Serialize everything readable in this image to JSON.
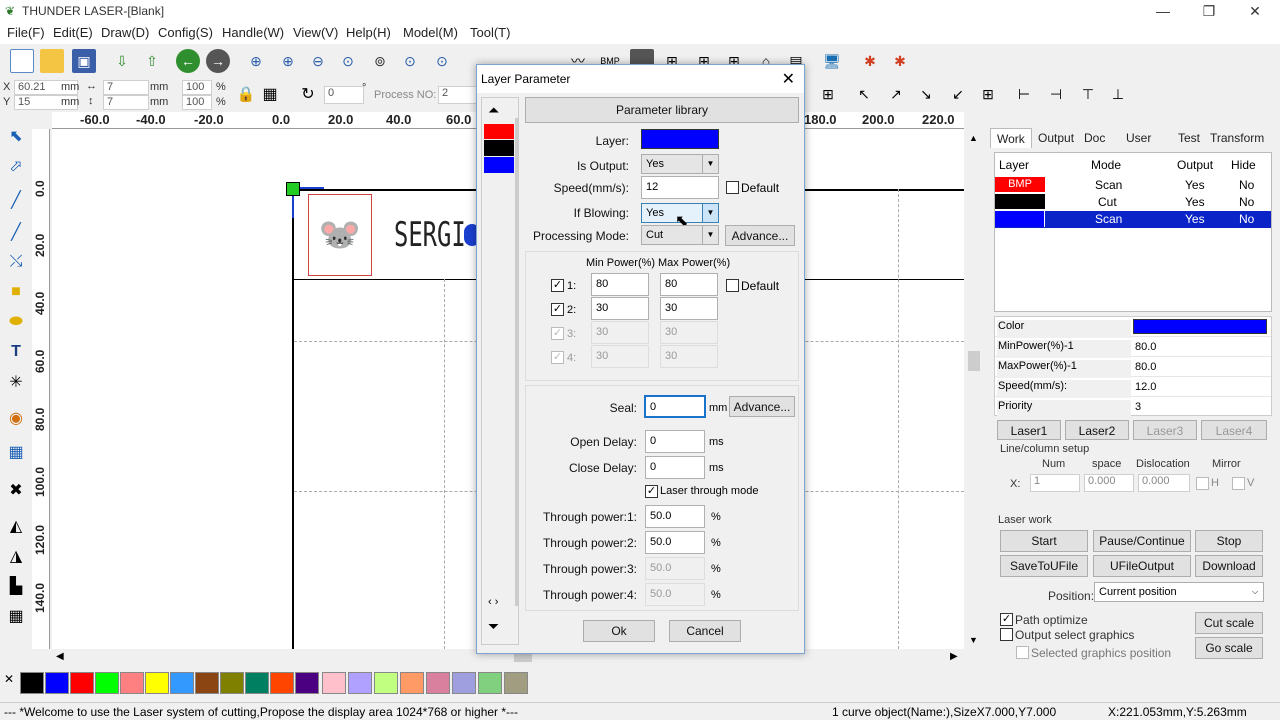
{
  "app": {
    "title": "THUNDER LASER-[Blank]"
  },
  "menu": [
    "File(F)",
    "Edit(E)",
    "Draw(D)",
    "Config(S)",
    "Handle(W)",
    "View(V)",
    "Help(H)",
    "Model(M)",
    "Tool(T)"
  ],
  "coords": {
    "x_label": "X",
    "x_value": "60.21",
    "y_label": "Y",
    "y_value": "15",
    "unit": "mm",
    "w_value": "7",
    "h_value": "7",
    "w_pct": "100",
    "h_pct": "100",
    "pct": "%",
    "rotate": "0",
    "deg": "°",
    "process_label": "Process NO:",
    "process_value": "2"
  },
  "ruler_h": [
    "-60.0",
    "-40.0",
    "-20.0",
    "0.0",
    "20.0",
    "40.0",
    "60.0",
    "180.0",
    "200.0",
    "220.0"
  ],
  "ruler_v": [
    "0.0",
    "20.0",
    "40.0",
    "60.0",
    "80.0",
    "100.0",
    "120.0",
    "140.0"
  ],
  "canvas": {
    "text": "SERGI"
  },
  "right_tabs": [
    "Work",
    "Output",
    "Doc",
    "User",
    "Test",
    "Transform"
  ],
  "layer_table": {
    "headers": [
      "Layer",
      "Mode",
      "Output",
      "Hide"
    ],
    "rows": [
      {
        "layer": "BMP",
        "color": "#ff0000",
        "mode": "Scan",
        "output": "Yes",
        "hide": "No"
      },
      {
        "layer": "",
        "color": "#000000",
        "mode": "Cut",
        "output": "Yes",
        "hide": "No"
      },
      {
        "layer": "",
        "color": "#0000ff",
        "mode": "Scan",
        "output": "Yes",
        "hide": "No"
      }
    ]
  },
  "props": [
    {
      "k": "Color",
      "v": ""
    },
    {
      "k": "MinPower(%)-1",
      "v": "80.0"
    },
    {
      "k": "MaxPower(%)-1",
      "v": "80.0"
    },
    {
      "k": "Speed(mm/s):",
      "v": "12.0"
    },
    {
      "k": "Priority",
      "v": "3"
    }
  ],
  "lasers": [
    "Laser1",
    "Laser2",
    "Laser3",
    "Laser4"
  ],
  "linecol": {
    "title": "Line/column setup",
    "num": "Num",
    "space": "space",
    "dislocation": "Dislocation",
    "mirror": "Mirror",
    "x": "X:",
    "num_v": "1",
    "space_v": "0.000",
    "disl_v": "0.000",
    "h": "H",
    "v": "V"
  },
  "laser_work": {
    "title": "Laser work",
    "start": "Start",
    "pause": "Pause/Continue",
    "stop": "Stop",
    "save": "SaveToUFile",
    "ufile": "UFileOutput",
    "download": "Download",
    "position_label": "Position:",
    "position_value": "Current position",
    "path_opt": "Path optimize",
    "output_sel": "Output select graphics",
    "sel_pos": "Selected graphics position",
    "cut_scale": "Cut scale",
    "go_scale": "Go scale"
  },
  "palette": [
    "#000000",
    "#0000ff",
    "#ff0000",
    "#00ff00",
    "#ff8080",
    "#ffff00",
    "#3399ff",
    "#8b4513",
    "#808000",
    "#008060",
    "#ff4500",
    "#4b0082",
    "#ffc0cb",
    "#b0a0ff",
    "#c0ff80",
    "#ff9966",
    "#d9809f",
    "#9f9fdf",
    "#80d080",
    "#a09d80"
  ],
  "status": {
    "left": "--- *Welcome to use the Laser system of cutting,Propose the display area 1024*768 or higher *---",
    "mid": "1 curve object(Name:),SizeX7.000,Y7.000",
    "right": "X:221.053mm,Y:5.263mm"
  },
  "dialog": {
    "title": "Layer Parameter",
    "param_lib": "Parameter library",
    "layer_label": "Layer:",
    "layer_color": "#0000ff",
    "is_output_label": "Is Output:",
    "is_output": "Yes",
    "speed_label": "Speed(mm/s):",
    "speed": "12",
    "default": "Default",
    "blowing_label": "If Blowing:",
    "blowing": "Yes",
    "mode_label": "Processing Mode:",
    "mode": "Cut",
    "advance": "Advance...",
    "min_power": "Min Power(%)",
    "max_power": "Max Power(%)",
    "powers": [
      {
        "n": "1:",
        "min": "80",
        "max": "80"
      },
      {
        "n": "2:",
        "min": "30",
        "max": "30"
      },
      {
        "n": "3:",
        "min": "30",
        "max": "30"
      },
      {
        "n": "4:",
        "min": "30",
        "max": "30"
      }
    ],
    "seal_label": "Seal:",
    "seal": "0",
    "mm": "mm",
    "open_delay_label": "Open Delay:",
    "open_delay": "0",
    "ms": "ms",
    "close_delay_label": "Close Delay:",
    "close_delay": "0",
    "through_mode": "Laser through mode",
    "through": [
      {
        "label": "Through power:1:",
        "v": "50.0"
      },
      {
        "label": "Through power:2:",
        "v": "50.0"
      },
      {
        "label": "Through power:3:",
        "v": "50.0"
      },
      {
        "label": "Through power:4:",
        "v": "50.0"
      }
    ],
    "pct": "%",
    "ok": "Ok",
    "cancel": "Cancel"
  }
}
